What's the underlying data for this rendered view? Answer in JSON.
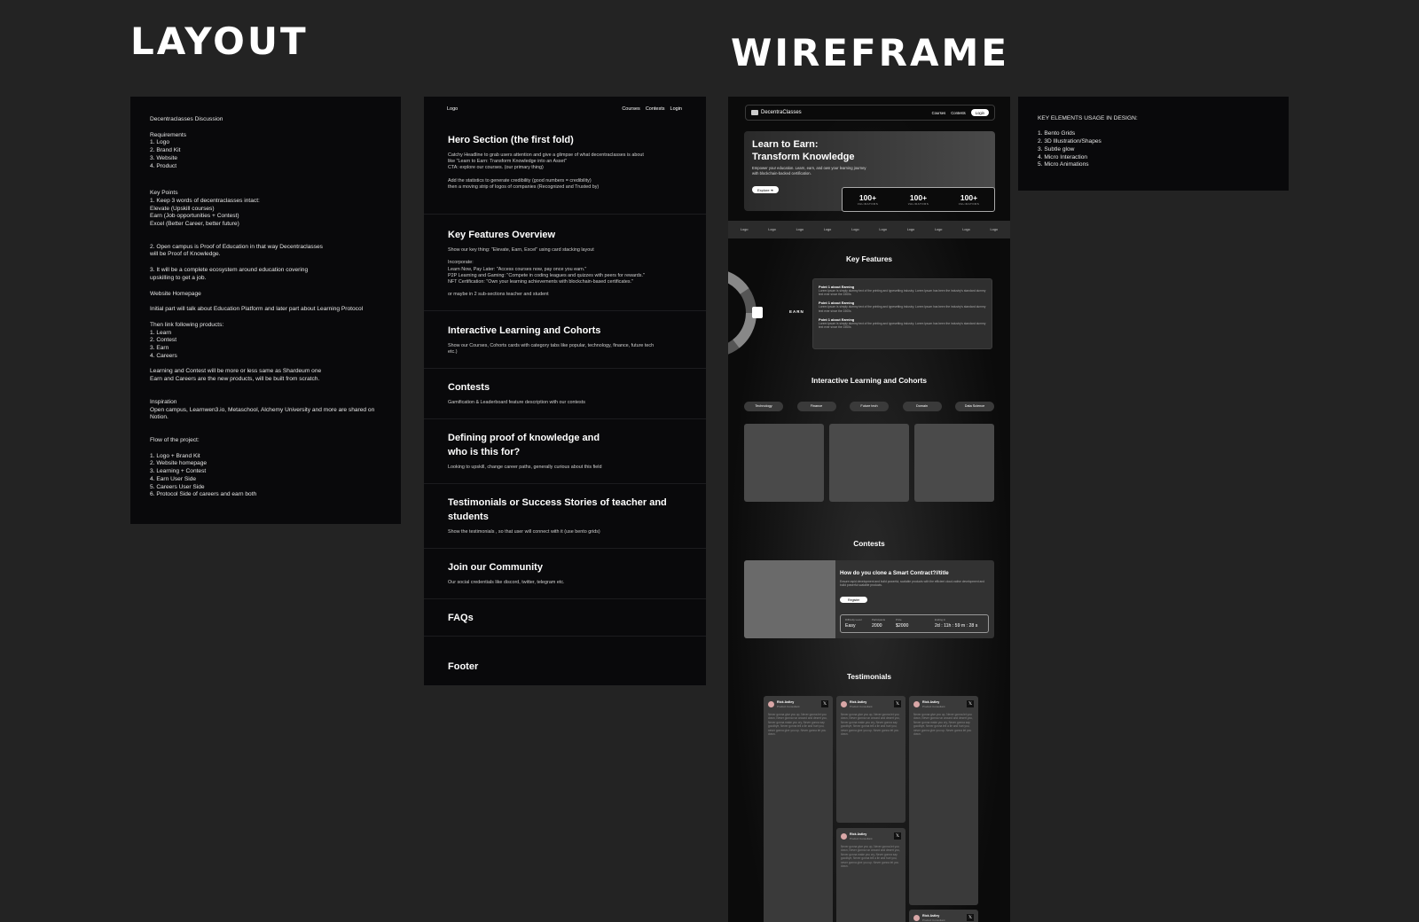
{
  "headings": {
    "layout": "LAYOUT",
    "wireframe": "WIREFRAME"
  },
  "notes": [
    "Decentraclasses Discussion",
    "Requirements\n1. Logo\n2. Brand Kit\n3. Website\n4. Product",
    "Key Points\n1. Keep 3 words of decentraclasses intact:\n    Elevate (Upskill courses)\n    Earn (Job opportunities + Contest)\n    Excel (Better Career, better future)",
    "2. Open campus is Proof of Education in that way Decentraclasses\n    will be Proof of Knowledge.",
    "3. It will be a complete ecosystem around education covering\n    upskilling to get a job.",
    "Website Homepage",
    "Initial part will talk about Education Platform and later part about Learning Protocol",
    "Then link following products:\n 1. Learn\n 2. Contest\n 3. Earn\n 4. Careers",
    "Learning and Contest will be more or less same as Shardeum one\n Earn and Careers are the new products, will be built from scratch.",
    "Inspiration\nOpen campus, Learnwen3.io, Metaschool, Alchemy University and more are shared on\nNotion.",
    "Flow of the project:",
    "1. Logo + Brand Kit\n2. Website homepage\n3. Learning + Contest\n4. Earn User Side\n5. Careers User Side\n6. Protocol Side of careers and earn both"
  ],
  "sitemap": {
    "logo": "Logo",
    "nav": [
      "Courses",
      "Contests",
      "Login"
    ],
    "sections": [
      {
        "title": "Hero Section (the first fold)",
        "desc": "Catchy Headline to grab users attention and give a glimpse of what decentraclasses is about\nlike \"Learn to Earn: Transform Knowledge into an Asset\"\nCTA: explore our courses. (our primary thing)\n\nAdd the statistics to generate credibility (good numbers = credibility)\nthen a moving strip of logos of companies (Recognized and Trusted by)"
      },
      {
        "title": "Key Features Overview",
        "desc": "Show our key thing: \"Elevate, Earn, Excel\" using card stacking layout\n\nIncorporate:\nLearn Now, Pay Later: \"Access courses now, pay once you earn.\"\nP2P Learning and Gaming: \"Compete in coding leagues and quizzes with peers for rewards.\"\nNFT Certification: \"Own your learning achievements with blockchain-based certificates.\"\n\nor maybe in 2 sub-sections teacher and student"
      },
      {
        "title": "Interactive Learning and Cohorts",
        "desc": "Show our Courses, Cohorts cards with category tabs like popular, technology, finance, future tech\netc.)"
      },
      {
        "title": "Contests",
        "desc": "Gamification & Leaderboard feature description with our contests"
      },
      {
        "title": "Defining proof of knowledge and\nwho is this for?",
        "desc": "Looking to upskill, change career paths, generally curious about this field"
      },
      {
        "title": "Testimonials or Success Stories of teacher and\nstudents",
        "desc": "Show the testimonials , so that user will connect with it (use bento grids)"
      },
      {
        "title": "Join our Community",
        "desc": "Our social credentials like discord, twitter, telegram etc."
      },
      {
        "title": "FAQs",
        "desc": ""
      },
      {
        "title": "Footer",
        "desc": ""
      }
    ]
  },
  "key_elements": "KEY ELEMENTS USAGE IN DESIGN:\n\n1. Bento Grids\n2. 3D Illustration/Shapes\n3. Subtle glow\n4. Micro Interaction\n5. Micro Animations",
  "wireframe": {
    "brand": "DecentraClasses",
    "nav": [
      "Courses",
      "Contests"
    ],
    "login": "Login",
    "hero_title": "Learn to Earn:\nTransform Knowledge",
    "hero_sub": "Empower your education. Learn, earn, and own your learning journey with blockchain-backed certification.",
    "explore": "Explore  ➜",
    "stats": [
      {
        "n": "100+",
        "l": "VALIDATORS"
      },
      {
        "n": "100+",
        "l": "VALIDATORS"
      },
      {
        "n": "100+",
        "l": "VALIDATORS"
      }
    ],
    "logos": [
      "Logo",
      "Logo",
      "Logo",
      "Logo",
      "Logo",
      "Logo",
      "Logo",
      "Logo",
      "Logo",
      "Logo"
    ],
    "key_features": "Key Features",
    "earn": "EARN",
    "points": [
      {
        "t": "Point 1 about Earning",
        "b": "Lorem Ipsum is simply dummy text of the printing and typesetting industry. Lorem Ipsum has been the industry's standard dummy text ever since the 1500s"
      },
      {
        "t": "Point 1 about Earning",
        "b": "Lorem Ipsum is simply dummy text of the printing and typesetting industry. Lorem Ipsum has been the industry's standard dummy text ever since the 1500s"
      },
      {
        "t": "Point 1 about Earning",
        "b": "Lorem Ipsum is simply dummy text of the printing and typesetting industry. Lorem Ipsum has been the industry's standard dummy text ever since the 1500s"
      }
    ],
    "cohorts_title": "Interactive Learning and Cohorts",
    "tabs": [
      "Technology",
      "Finance",
      "Future tech",
      "Domain",
      "Data Science"
    ],
    "contests_title": "Contests",
    "contest": {
      "title": "How do you clone a Smart Contract?//title",
      "desc": "Ensure rapid development and build powerful, scalable products with the efficient cloud-native development and build powerful scalable products.",
      "register": "Register",
      "info": [
        {
          "k": "Difficulty Level",
          "v": "Easy"
        },
        {
          "k": "Participants",
          "v": "2000"
        },
        {
          "k": "Prize",
          "v": "$2000"
        },
        {
          "k": "Ending in",
          "v": "2d : 11h : 59 m : 28 s"
        }
      ]
    },
    "testimonials_title": "Testimonials",
    "testimonial": {
      "name": "Rick Astley",
      "role": "Product Consultant",
      "x": "𝕏",
      "text": "Never gonna give you up, Never gonna let you down, Never gonna run around and desert you, Never gonna make you cry, Never gonna say goodbye, Never gonna tell a lie and hurt you, never gonna give you up. Never gonna let you down."
    }
  }
}
